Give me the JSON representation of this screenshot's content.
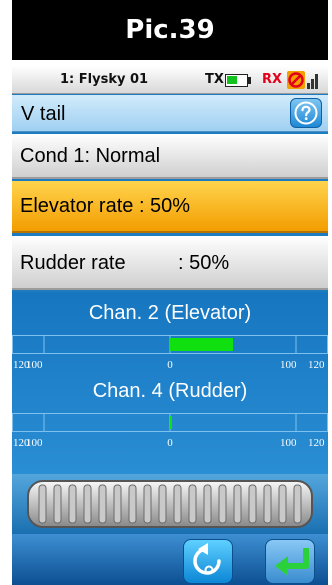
{
  "caption": "Pic.39",
  "status": {
    "model_name": "1: Flysky 01",
    "tx_label": "TX",
    "rx_label": "RX",
    "tx_battery_level": 0.55,
    "battery_color": "#12c21e",
    "rx_icon": "no-signal-icon",
    "signal_icon": "signal-bars-icon"
  },
  "page": {
    "title": "V tail",
    "help_icon": "help-icon"
  },
  "condition": "Cond 1: Normal",
  "elevator_rate": "Elevator rate : 50%",
  "rudder_rate": {
    "label": "Rudder rate",
    "value": ": 50%"
  },
  "channels": [
    {
      "title": "Chan. 2 (Elevator)",
      "scale": [
        "120",
        "100",
        "0",
        "100",
        "120"
      ],
      "output_from": 0,
      "output_to": 50,
      "bar_color": "#10e010"
    },
    {
      "title": "Chan. 4 (Rudder)",
      "scale": [
        "120",
        "100",
        "0",
        "100",
        "120"
      ],
      "output_from": 0,
      "output_to": 0,
      "bar_color": "#10e010"
    }
  ],
  "controls": {
    "wheel_icon": "scroll-wheel",
    "back_icon": "rotate-back-icon",
    "exit_icon": "return-arrow-icon"
  },
  "colors": {
    "screen_blue": "#1d7bc0",
    "highlight_orange": "#f7b21a",
    "rx_red": "#e4001b"
  }
}
